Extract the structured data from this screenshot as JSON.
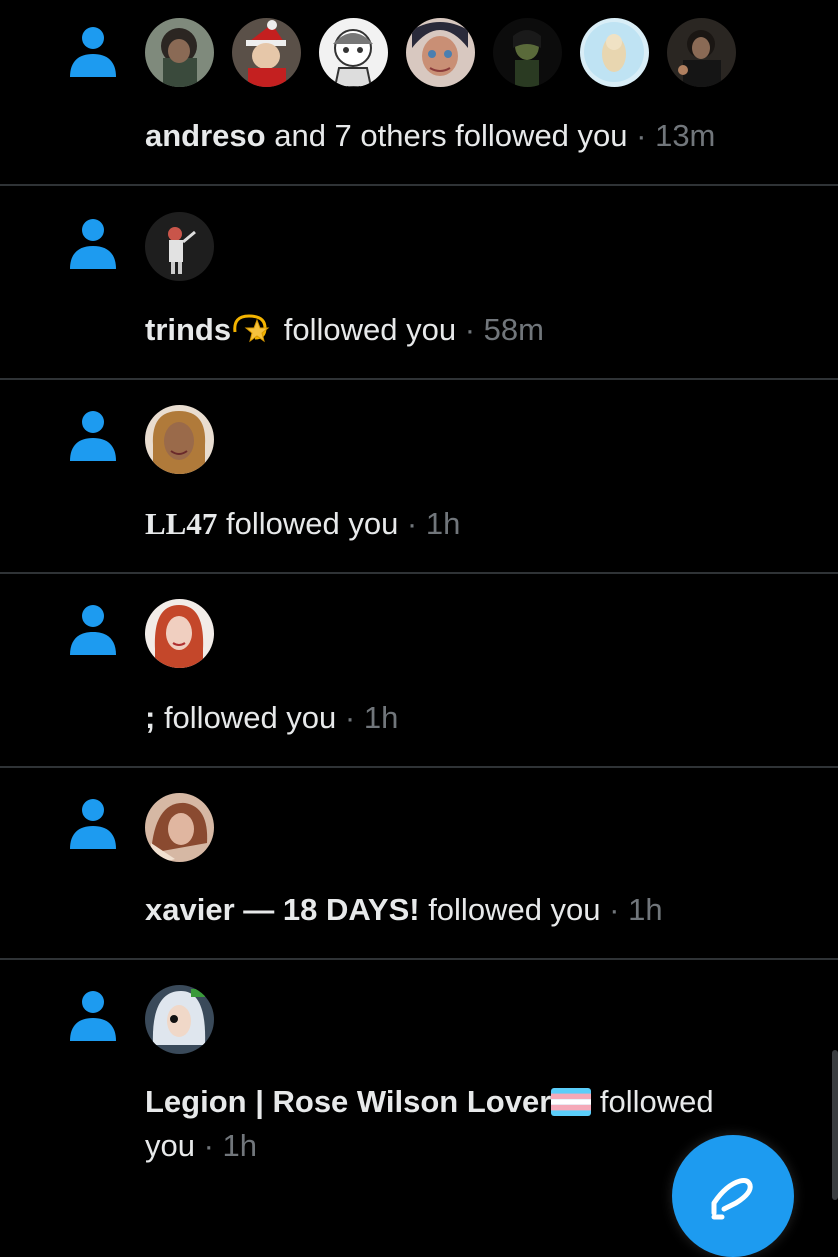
{
  "theme": {
    "background": "#000000",
    "accent": "#1d9bf0",
    "text": "#e7e9ea",
    "muted": "#71767b",
    "divider": "#2f3336"
  },
  "notifications": [
    {
      "type_icon": "person-icon",
      "avatar_count": 7,
      "name": "andreso",
      "action": " and 7 others followed you",
      "separator": " · ",
      "time": "13m"
    },
    {
      "type_icon": "person-icon",
      "avatar_count": 1,
      "name": "trinds",
      "name_emoji": "dizzy-star-emoji",
      "action": " followed you",
      "separator": " · ",
      "time": "58m"
    },
    {
      "type_icon": "person-icon",
      "avatar_count": 1,
      "name": "LL47",
      "action": " followed you",
      "separator": " · ",
      "time": "1h"
    },
    {
      "type_icon": "person-icon",
      "avatar_count": 1,
      "name": ";",
      "action": " followed you",
      "separator": " · ",
      "time": "1h"
    },
    {
      "type_icon": "person-icon",
      "avatar_count": 1,
      "name": "xavier — 18 DAYS!",
      "action": " followed you",
      "separator": " · ",
      "time": "1h"
    },
    {
      "type_icon": "person-icon",
      "avatar_count": 1,
      "name": "Legion | Rose Wilson Lover",
      "name_emoji": "transgender-flag-emoji",
      "action": " followed you",
      "separator": " · ",
      "time": "1h"
    }
  ],
  "compose_button": {
    "icon": "compose-icon"
  }
}
